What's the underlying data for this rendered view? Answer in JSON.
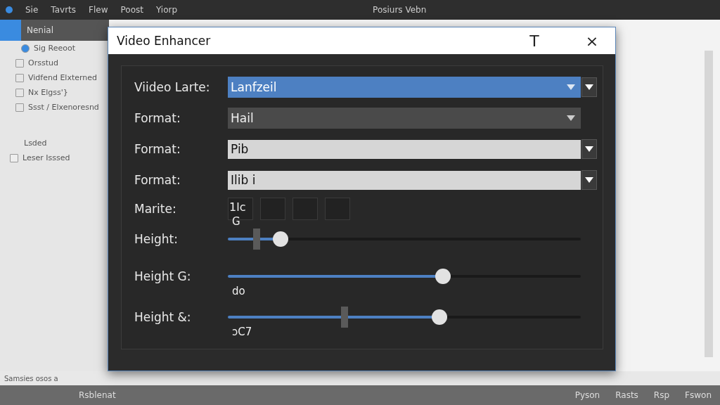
{
  "app": {
    "menu": [
      "Sie",
      "Tavrts",
      "Flew",
      "Poost",
      "Yiorp"
    ],
    "title": "Posiurs Vebn"
  },
  "sidebar": {
    "header": "Nenial",
    "items": [
      "Sig Reeoot",
      "Orsstud",
      "Vidfend Elxterned",
      "Nx Elgss'}",
      "Ssst / Elxenoresnd"
    ],
    "section": "Lsded",
    "footer_item": "Leser Isssed"
  },
  "status_bar": "Samsies osos a",
  "taskbar": {
    "app": "Rsblenat",
    "tray": [
      "Pyson",
      "Rasts",
      "Rsp",
      "Fswon"
    ]
  },
  "dialog": {
    "title": "Video Enhancer",
    "title_buttons": [
      "T",
      "×"
    ],
    "rows": [
      {
        "kind": "highlighted",
        "label": "Viideo Larte:",
        "value": "Lanfzeil"
      },
      {
        "kind": "dropdown",
        "label": "Format:",
        "value": "Hail"
      },
      {
        "kind": "entry",
        "label": "Format:",
        "value": "Pib"
      },
      {
        "kind": "entry",
        "label": "Format:",
        "value": "Ilib i"
      },
      {
        "kind": "swatches",
        "label": "Marite:",
        "value": "1lc",
        "swatches": [
          {
            "kind": "empty"
          },
          {
            "kind": "empty"
          },
          {
            "kind": "empty"
          },
          {
            "kind": "empty"
          }
        ]
      },
      {
        "kind": "slider",
        "label": "Height:",
        "level": 0.15,
        "marker": true,
        "caption_above": "G"
      },
      {
        "kind": "slider",
        "label": "Height G:",
        "level": 0.61,
        "marker": false,
        "caption_below": "do"
      },
      {
        "kind": "slider",
        "label": "Height &:",
        "level": 0.6,
        "marker": true,
        "caption_below": "ɔC7"
      }
    ]
  }
}
